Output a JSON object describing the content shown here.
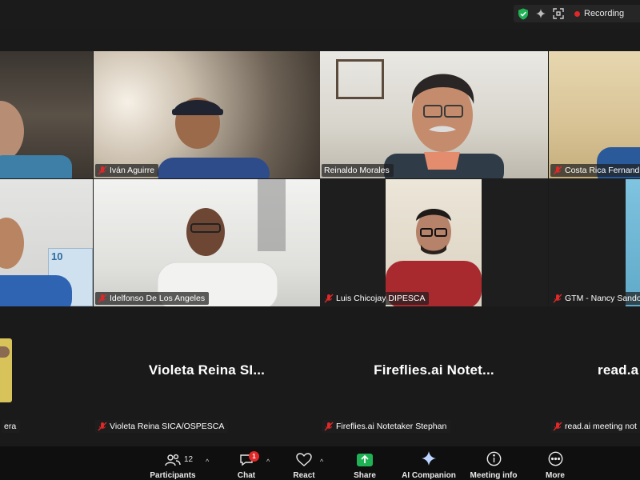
{
  "top_bar": {
    "recording_label": "Recording",
    "colors": {
      "shield": "#1fb255",
      "recording_dot": "#e02828"
    }
  },
  "participants": [
    {
      "name": "Iván Aguirre",
      "muted": true
    },
    {
      "name": "Reinaldo Morales",
      "muted": false,
      "active_speaker": true
    },
    {
      "name": "Costa Rica Fernand",
      "muted": true
    },
    {
      "name": "Idelfonso De Los Angeles",
      "muted": true
    },
    {
      "name": "Luis Chicojay DIPESCA",
      "muted": true
    },
    {
      "name": "GTM - Nancy Sando",
      "muted": true
    }
  ],
  "left_partial_tile": {
    "name_fragment": "era"
  },
  "video_off_tiles": [
    {
      "display_name": "Violeta Reina SI...",
      "name_tag": "Violeta Reina SICA/OSPESCA"
    },
    {
      "display_name": "Fireflies.ai Notet...",
      "name_tag": "Fireflies.ai Notetaker Stephan"
    },
    {
      "display_name": "read.a",
      "name_tag": "read.ai meeting not"
    }
  ],
  "toolbar": {
    "participants_label": "Participants",
    "participants_count": "12",
    "chat_label": "Chat",
    "chat_badge": "1",
    "react_label": "React",
    "share_label": "Share",
    "ai_companion_label": "AI Companion",
    "meeting_info_label": "Meeting info",
    "more_label": "More",
    "colors": {
      "share_green": "#1fb255",
      "badge_red": "#e02828"
    }
  },
  "icons": {
    "shield": "shield-check-icon",
    "sparkle": "sparkle-icon",
    "fullscreen": "fullscreen-icon",
    "mic_muted": "mic-muted-icon"
  }
}
